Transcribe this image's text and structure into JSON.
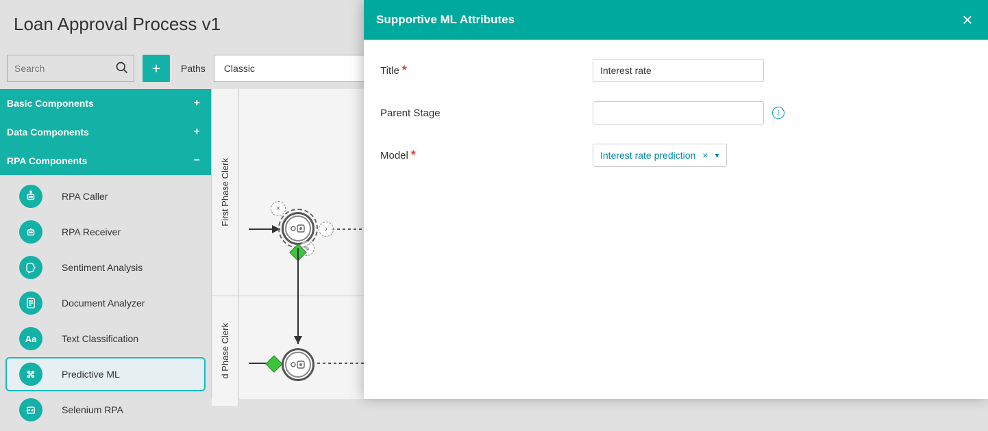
{
  "header": {
    "title": "Loan Approval Process v1"
  },
  "toolbar": {
    "search_placeholder": "Search",
    "paths_label": "Paths",
    "paths_selected": "Classic"
  },
  "sidebar": {
    "sections": [
      {
        "label": "Basic Components",
        "sign": "+"
      },
      {
        "label": "Data Components",
        "sign": "+"
      },
      {
        "label": "RPA Components",
        "sign": "−"
      }
    ],
    "rpa_items": [
      {
        "label": "RPA Caller"
      },
      {
        "label": "RPA Receiver"
      },
      {
        "label": "Sentiment Analysis"
      },
      {
        "label": "Document Analyzer"
      },
      {
        "label": "Text Classification"
      },
      {
        "label": "Predictive ML"
      },
      {
        "label": "Selenium RPA"
      }
    ]
  },
  "canvas": {
    "lanes": [
      {
        "label": "First Phase Clerk"
      },
      {
        "label": "d Phase Clerk"
      }
    ]
  },
  "panel": {
    "title": "Supportive ML Attributes",
    "fields": {
      "title_label": "Title",
      "title_value": "Interest rate",
      "parent_stage_label": "Parent Stage",
      "parent_stage_value": "",
      "model_label": "Model",
      "model_value": "Interest rate prediction"
    }
  }
}
